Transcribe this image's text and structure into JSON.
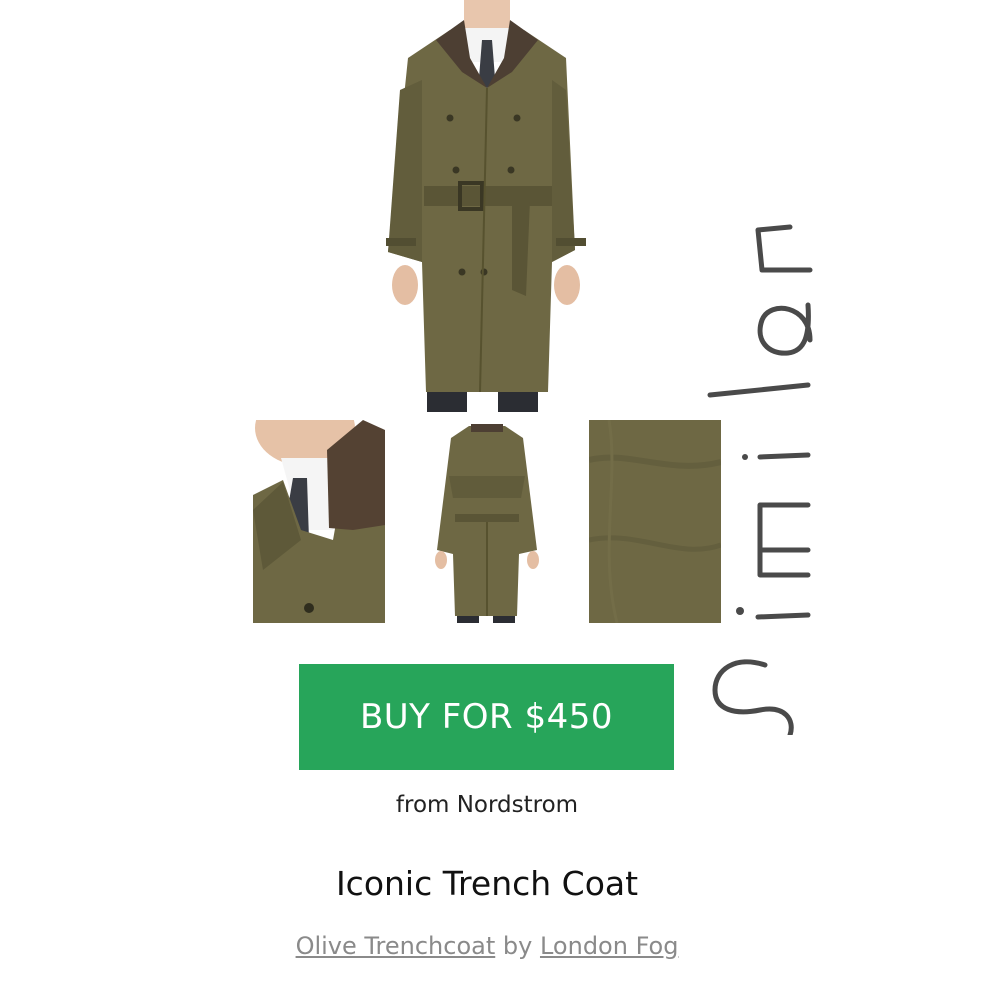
{
  "product": {
    "buy_label": "BUY FOR $450",
    "from_label": "from Nordstrom",
    "title": "Iconic Trench Coat",
    "item_link": "Olive Trenchcoat",
    "by_word": "by",
    "brand_link": "London Fog"
  },
  "similar_label": "Similar",
  "images": {
    "main": "main-photo-trench-coat-front",
    "thumbs": [
      "collar-detail",
      "back-view",
      "fabric-swatch"
    ]
  },
  "colors": {
    "button": "#27a55a",
    "coat": "#6e6844",
    "coat_dark": "#524e32",
    "byline": "#8a8a8a"
  }
}
